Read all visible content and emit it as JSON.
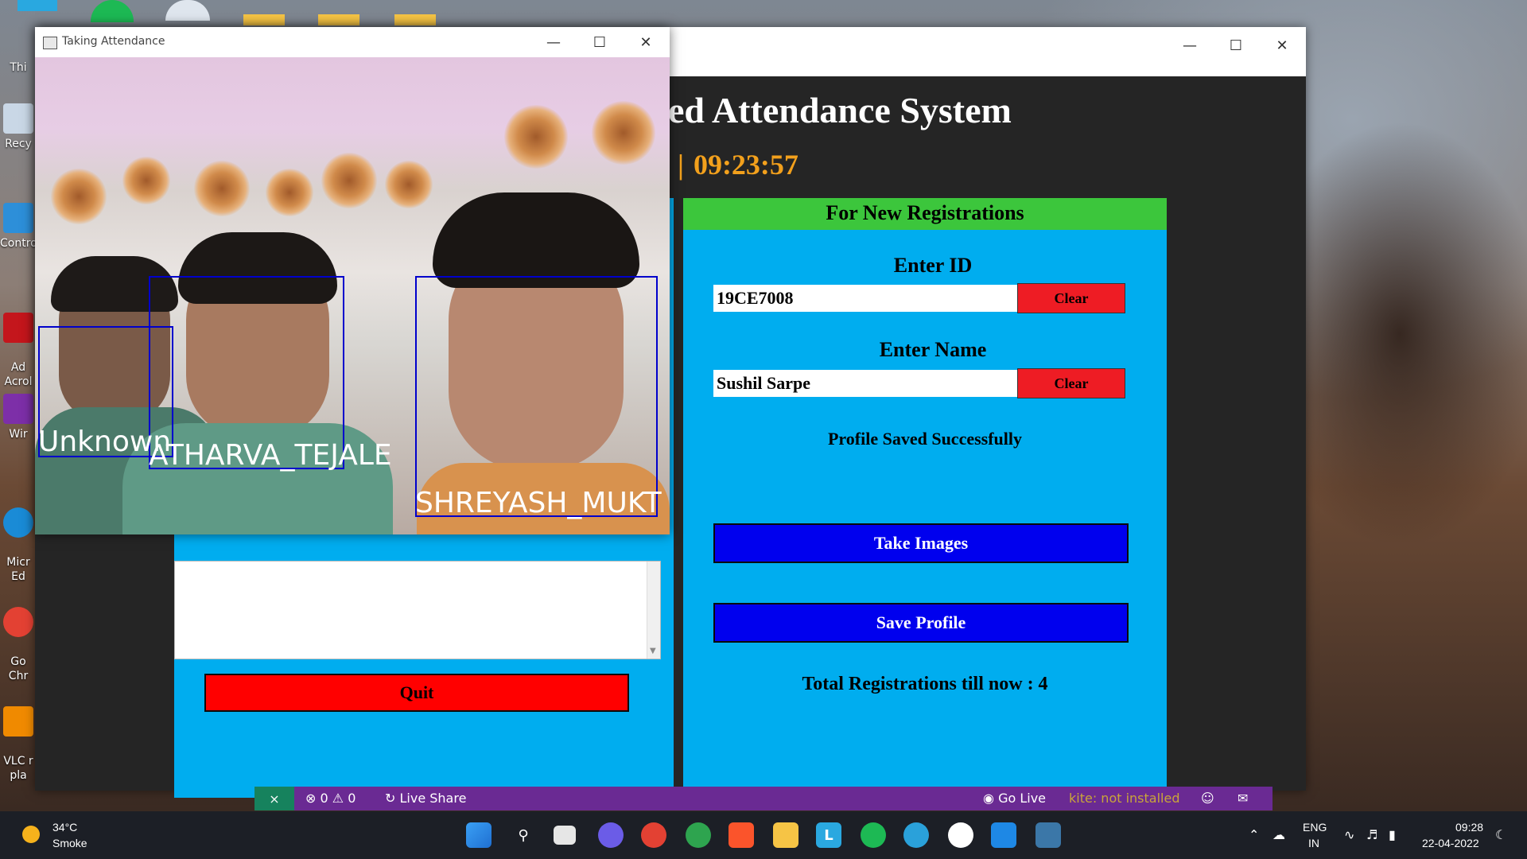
{
  "desktop": {
    "icons": [
      {
        "label": "Thi",
        "color": "#1f9be0"
      },
      {
        "label": "Recy",
        "color": "#c9d7e6"
      },
      {
        "label": "Contro",
        "color": "#2d8fd9"
      },
      {
        "label": "Ad\nAcrol",
        "color": "#c4161c"
      },
      {
        "label": "Wir",
        "color": "#7d2fa8"
      },
      {
        "label": "Micr\nEd",
        "color": "#1a8bd6"
      },
      {
        "label": "Go\nChr",
        "color": "#e34133"
      },
      {
        "label": "VLC r\npla",
        "color": "#f08a00"
      }
    ]
  },
  "main_window": {
    "heading": "ed Attendance System",
    "separator": "|",
    "clock": "09:23:57",
    "quit_label": "Quit",
    "registration": {
      "header": "For New Registrations",
      "id_label": "Enter ID",
      "id_value": "19CE7008",
      "name_label": "Enter Name",
      "name_value": "Sushil Sarpe",
      "clear_label": "Clear",
      "status": "Profile Saved Successfully",
      "take_images_label": "Take Images",
      "save_profile_label": "Save Profile",
      "total_label": "Total Registrations till now  : 4"
    }
  },
  "camera_window": {
    "title": "Taking Attendance",
    "faces": [
      "Unknown",
      "ATHARVA_TEJALE",
      "SHREYASH_MUKT"
    ]
  },
  "vscode_status": {
    "problems": "⊗ 0 ⚠ 0",
    "live_share": "Live Share",
    "go_live": "Go Live",
    "kite": "kite: not installed"
  },
  "taskbar": {
    "temperature": "34°C",
    "weather": "Smoke",
    "lang1": "ENG",
    "lang2": "IN",
    "time": "09:28",
    "date": "22-04-2022"
  }
}
